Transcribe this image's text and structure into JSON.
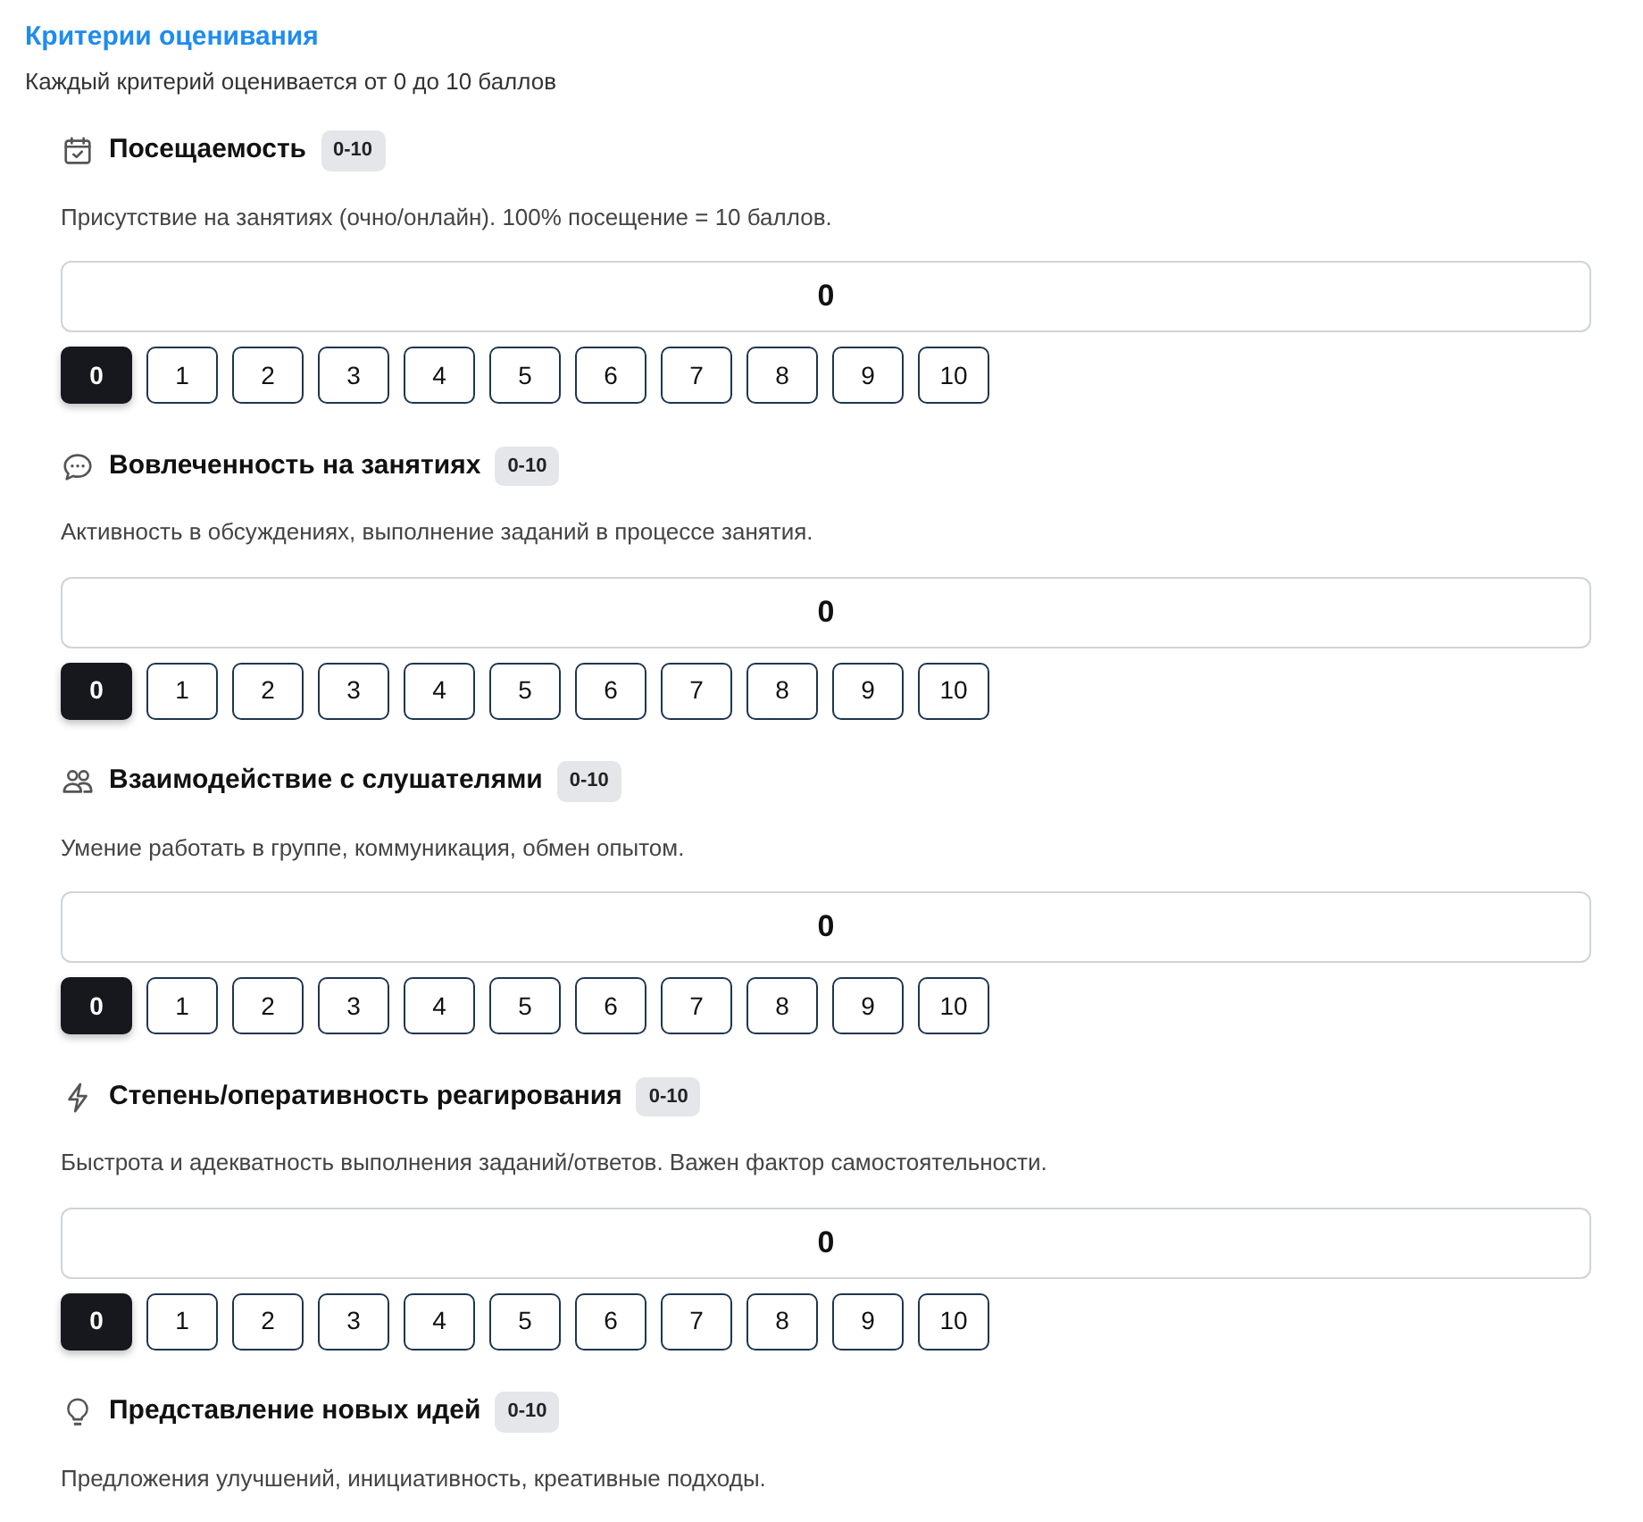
{
  "heading": "Критерии оценивания",
  "subtitle": "Каждый критерий оценивается от 0 до 10 баллов",
  "criteria": [
    {
      "kind": "calendar",
      "title": "Посещаемость",
      "range": "0-10",
      "description": "Присутствие на занятиях (очно/онлайн). 100% посещение = 10 баллов.",
      "value": "0",
      "scale": [
        {
          "label": "0",
          "selected": true
        },
        {
          "label": "1",
          "selected": false
        },
        {
          "label": "2",
          "selected": false
        },
        {
          "label": "3",
          "selected": false
        },
        {
          "label": "4",
          "selected": false
        },
        {
          "label": "5",
          "selected": false
        },
        {
          "label": "6",
          "selected": false
        },
        {
          "label": "7",
          "selected": false
        },
        {
          "label": "8",
          "selected": false
        },
        {
          "label": "9",
          "selected": false
        },
        {
          "label": "10",
          "selected": false
        }
      ]
    },
    {
      "kind": "chat",
      "title": "Вовлеченность на занятиях",
      "range": "0-10",
      "description": "Активность в обсуждениях, выполнение заданий в процессе занятия.",
      "value": "0",
      "scale": [
        {
          "label": "0",
          "selected": true
        },
        {
          "label": "1",
          "selected": false
        },
        {
          "label": "2",
          "selected": false
        },
        {
          "label": "3",
          "selected": false
        },
        {
          "label": "4",
          "selected": false
        },
        {
          "label": "5",
          "selected": false
        },
        {
          "label": "6",
          "selected": false
        },
        {
          "label": "7",
          "selected": false
        },
        {
          "label": "8",
          "selected": false
        },
        {
          "label": "9",
          "selected": false
        },
        {
          "label": "10",
          "selected": false
        }
      ]
    },
    {
      "kind": "people",
      "title": "Взаимодействие с слушателями",
      "range": "0-10",
      "description": "Умение работать в группе, коммуникация, обмен опытом.",
      "value": "0",
      "scale": [
        {
          "label": "0",
          "selected": true
        },
        {
          "label": "1",
          "selected": false
        },
        {
          "label": "2",
          "selected": false
        },
        {
          "label": "3",
          "selected": false
        },
        {
          "label": "4",
          "selected": false
        },
        {
          "label": "5",
          "selected": false
        },
        {
          "label": "6",
          "selected": false
        },
        {
          "label": "7",
          "selected": false
        },
        {
          "label": "8",
          "selected": false
        },
        {
          "label": "9",
          "selected": false
        },
        {
          "label": "10",
          "selected": false
        }
      ]
    },
    {
      "kind": "bolt",
      "title": "Степень/оперативность реагирования",
      "range": "0-10",
      "description": "Быстрота и адекватность выполнения заданий/ответов. Важен фактор самостоятельности.",
      "value": "0",
      "scale": [
        {
          "label": "0",
          "selected": true
        },
        {
          "label": "1",
          "selected": false
        },
        {
          "label": "2",
          "selected": false
        },
        {
          "label": "3",
          "selected": false
        },
        {
          "label": "4",
          "selected": false
        },
        {
          "label": "5",
          "selected": false
        },
        {
          "label": "6",
          "selected": false
        },
        {
          "label": "7",
          "selected": false
        },
        {
          "label": "8",
          "selected": false
        },
        {
          "label": "9",
          "selected": false
        },
        {
          "label": "10",
          "selected": false
        }
      ]
    },
    {
      "kind": "bulb",
      "title": "Представление новых идей",
      "range": "0-10",
      "description": "Предложения улучшений, инициативность, креативные подходы."
    }
  ]
}
